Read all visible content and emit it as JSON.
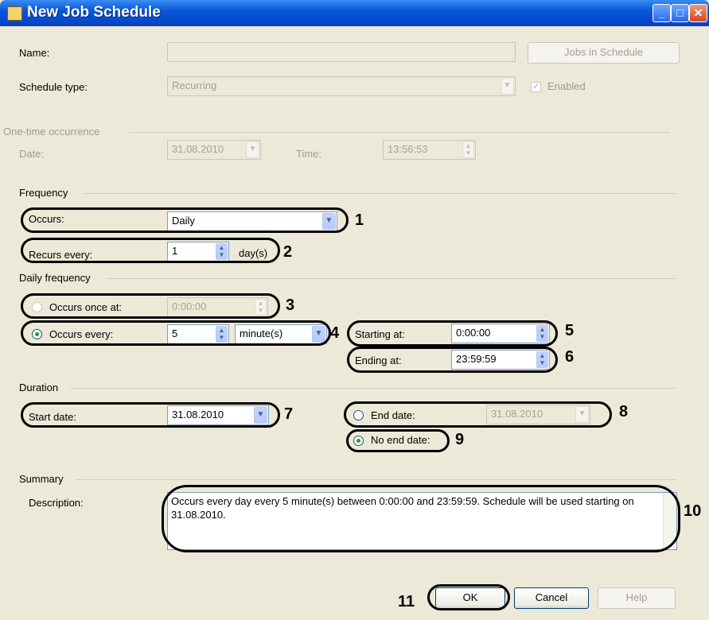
{
  "window": {
    "title": "New Job Schedule"
  },
  "general": {
    "name_label": "Name:",
    "name_value": "",
    "jobs_button": "Jobs in Schedule",
    "schedule_type_label": "Schedule type:",
    "schedule_type_value": "Recurring",
    "enabled_label": "Enabled",
    "enabled_checked": true
  },
  "one_time": {
    "heading": "One-time occurrence",
    "date_label": "Date:",
    "date_value": "31.08.2010",
    "time_label": "Time:",
    "time_value": "13:56:53"
  },
  "frequency": {
    "heading": "Frequency",
    "occurs_label": "Occurs:",
    "occurs_value": "Daily",
    "recurs_label": "Recurs every:",
    "recurs_value": "1",
    "recurs_unit": "day(s)"
  },
  "daily_frequency": {
    "heading": "Daily frequency",
    "once_label": "Occurs once at:",
    "once_value": "0:00:00",
    "every_label": "Occurs every:",
    "every_value": "5",
    "every_unit": "minute(s)",
    "starting_label": "Starting at:",
    "starting_value": "0:00:00",
    "ending_label": "Ending at:",
    "ending_value": "23:59:59"
  },
  "duration": {
    "heading": "Duration",
    "start_label": "Start date:",
    "start_value": "31.08.2010",
    "end_label": "End date:",
    "end_value": "31.08.2010",
    "no_end_label": "No end date:"
  },
  "summary": {
    "heading": "Summary",
    "description_label": "Description:",
    "description_text": "Occurs every day every 5 minute(s) between 0:00:00 and 23:59:59. Schedule will be used starting on 31.08.2010."
  },
  "buttons": {
    "ok": "OK",
    "cancel": "Cancel",
    "help": "Help"
  },
  "callouts": [
    "1",
    "2",
    "3",
    "4",
    "5",
    "6",
    "7",
    "8",
    "9",
    "10",
    "11"
  ]
}
